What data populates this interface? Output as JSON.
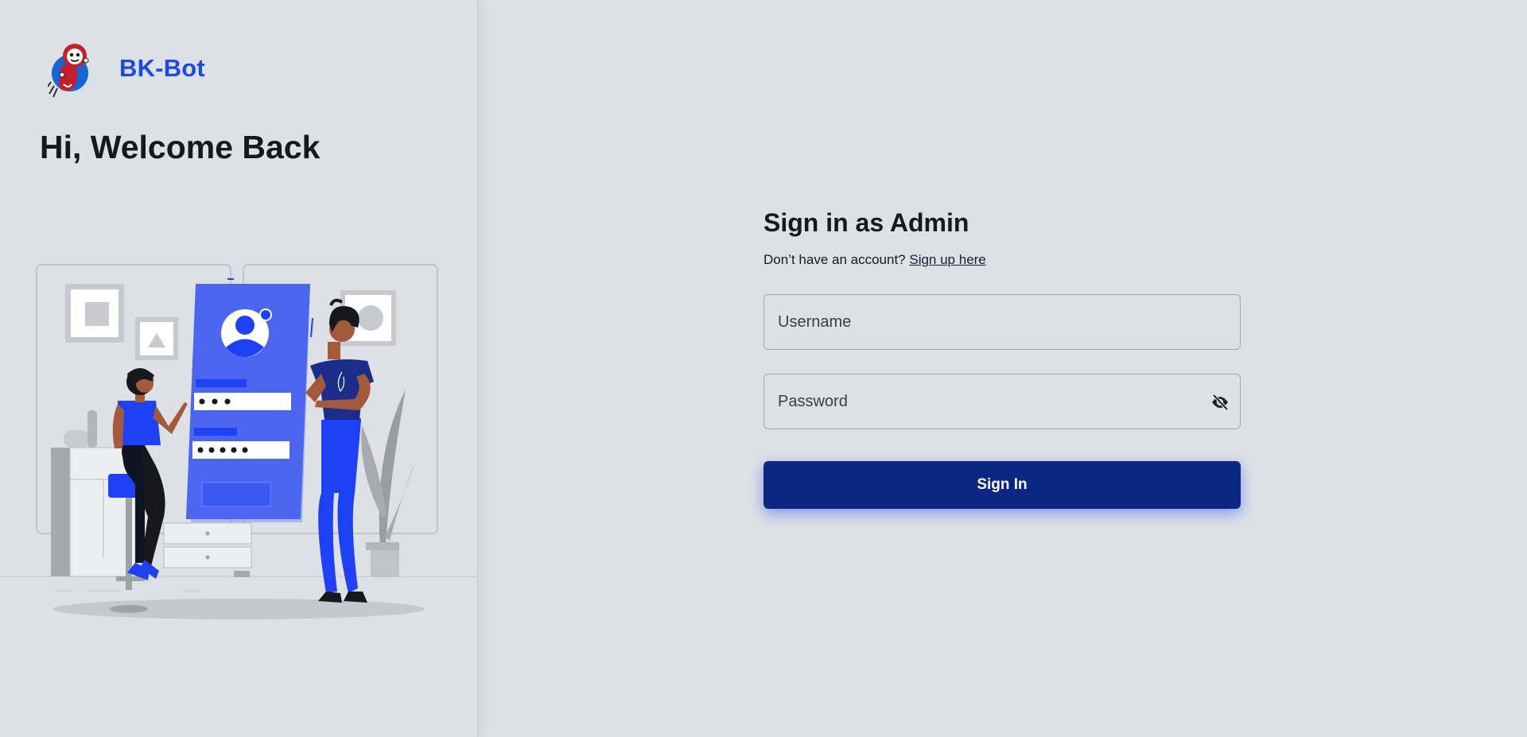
{
  "brand": {
    "name": "BK-Bot",
    "logo_icon": "robot-mascot-icon"
  },
  "left": {
    "welcome": "Hi, Welcome Back",
    "illustration": "login-illustration"
  },
  "form": {
    "title": "Sign in as Admin",
    "signup_prompt": "Don’t have an account?",
    "signup_link": "Sign up here",
    "username": {
      "placeholder": "Username",
      "value": ""
    },
    "password": {
      "placeholder": "Password",
      "value": "",
      "toggle_icon": "eye-slash-icon"
    },
    "submit_label": "Sign In"
  },
  "colors": {
    "background": "#dde1e6",
    "brand": "#1d4ae0",
    "button": "#0c2781",
    "illustration_accent": "#1f41f5"
  }
}
